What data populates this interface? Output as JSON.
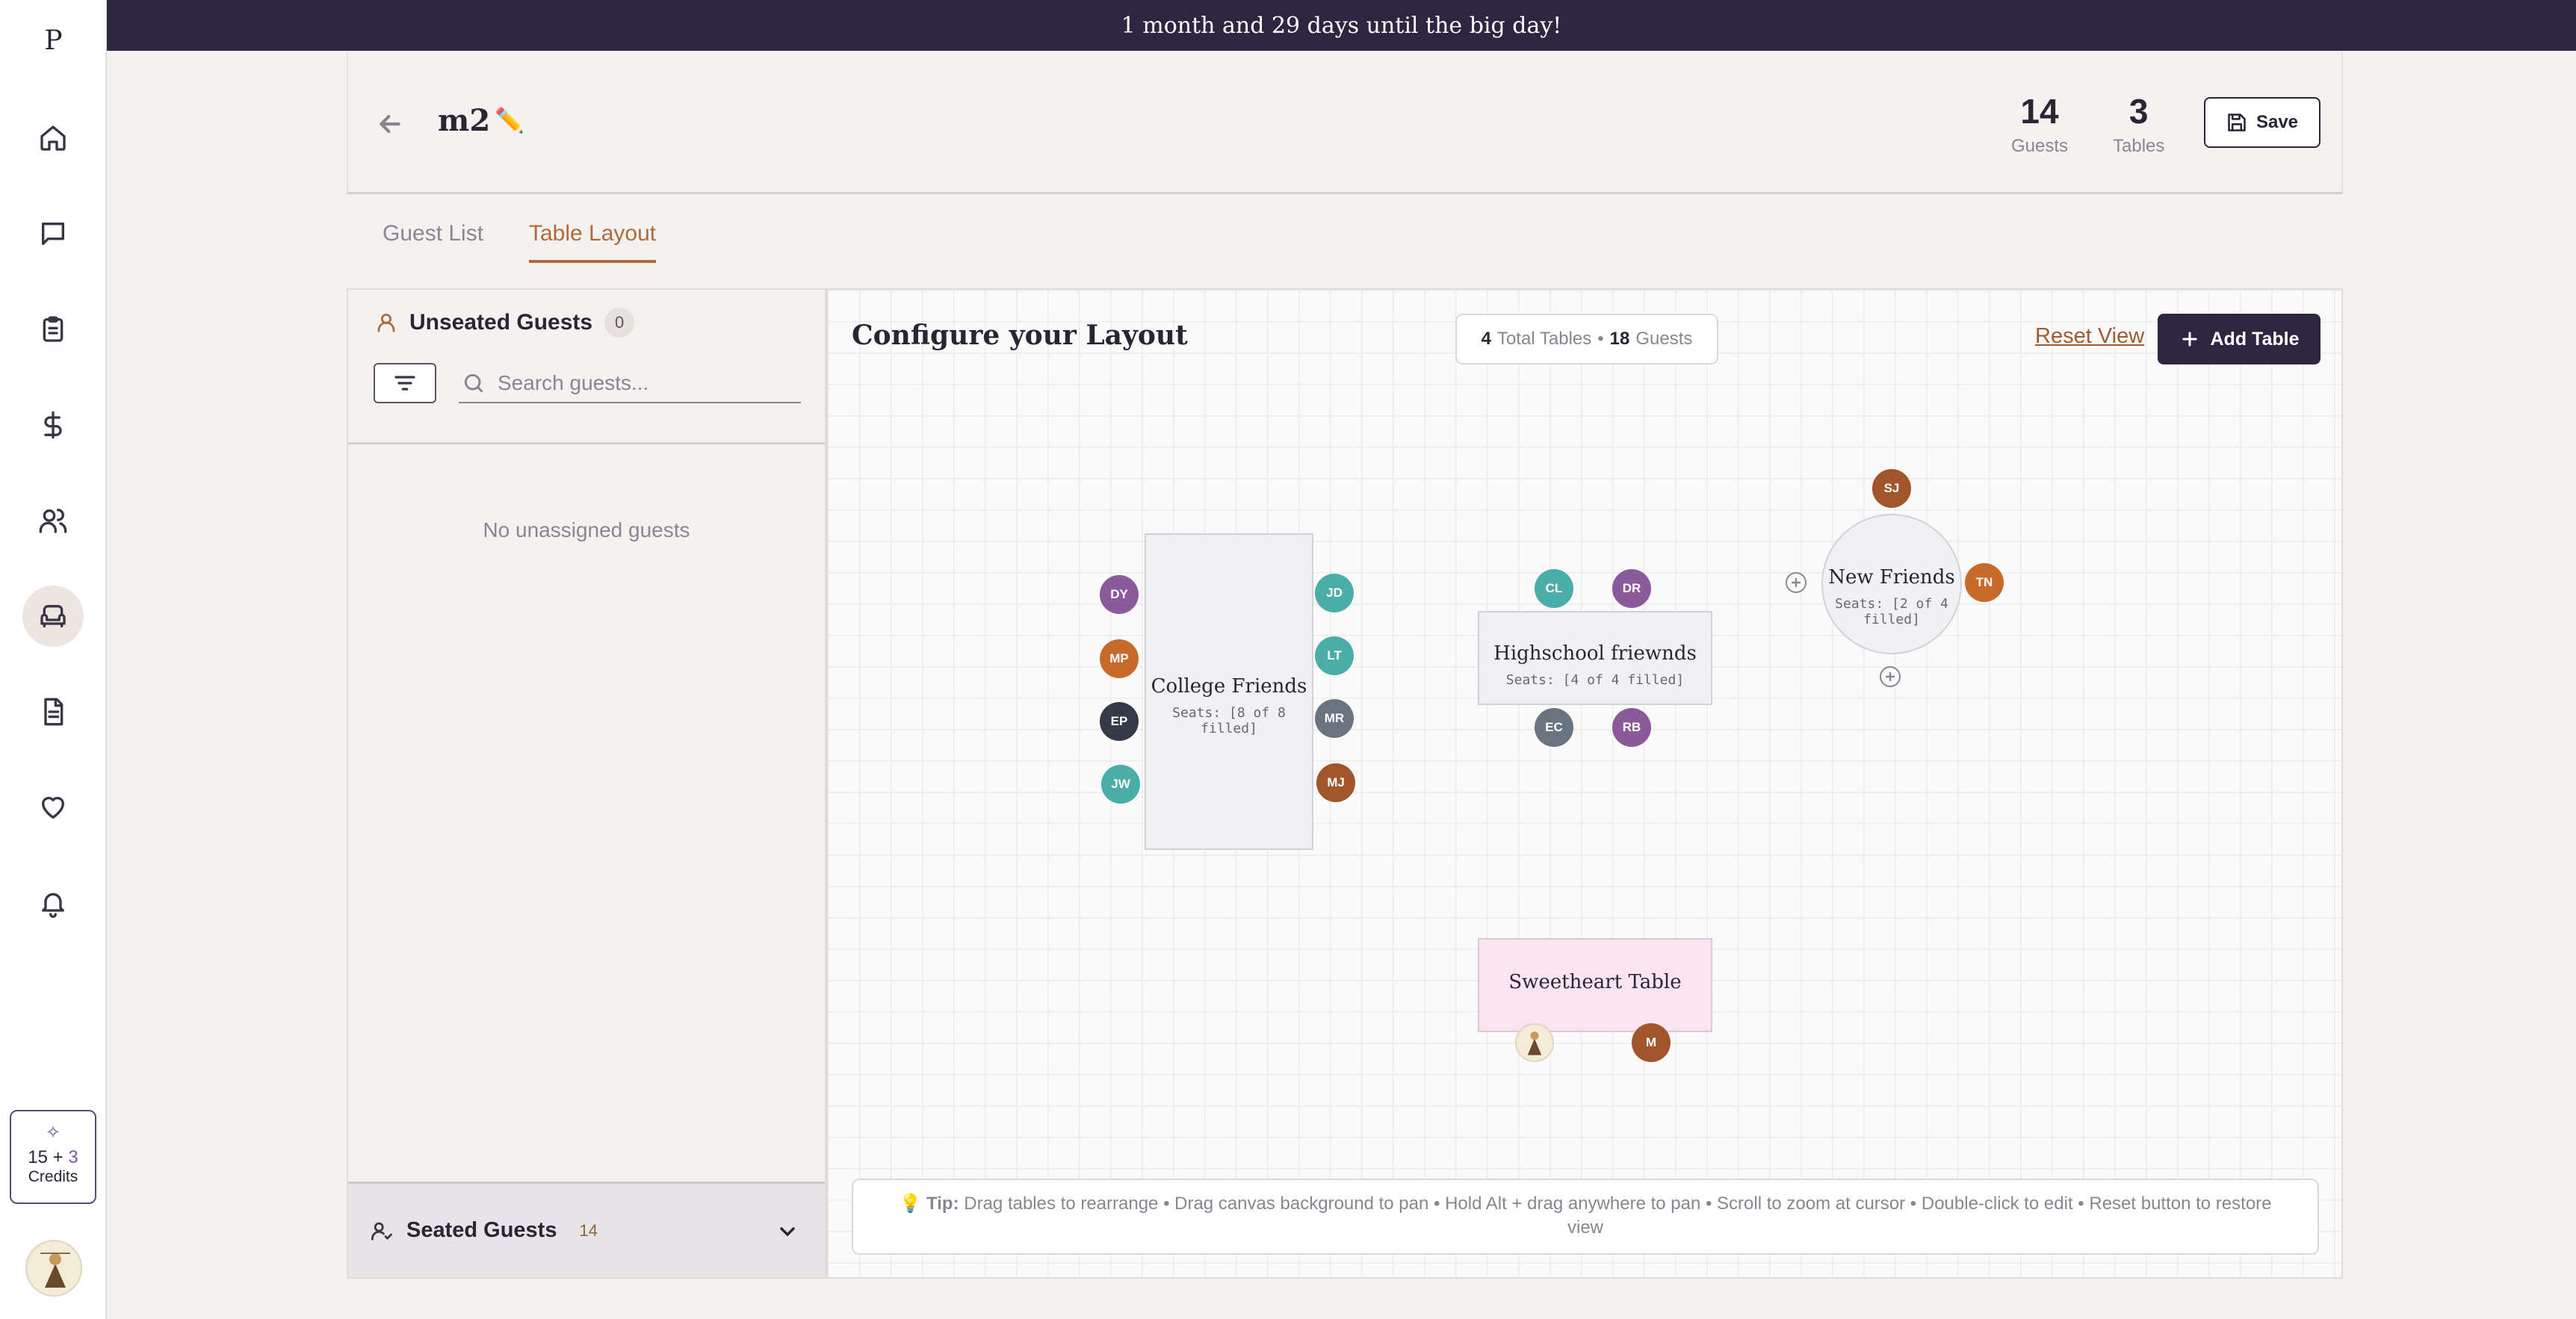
{
  "sidebar": {
    "logo": "P",
    "items": [
      {
        "name": "home",
        "active": false
      },
      {
        "name": "messages",
        "active": false
      },
      {
        "name": "checklist",
        "active": false
      },
      {
        "name": "budget",
        "active": false
      },
      {
        "name": "guests",
        "active": false
      },
      {
        "name": "seating",
        "active": true
      },
      {
        "name": "documents",
        "active": false
      },
      {
        "name": "favorites",
        "active": false
      },
      {
        "name": "notifications",
        "active": false
      }
    ],
    "credits": {
      "base": "15",
      "plus": "+",
      "bonus": "3",
      "label": "Credits"
    }
  },
  "banner": {
    "text": "1 month and 29 days until the big day!"
  },
  "header": {
    "title": "m2",
    "edit_icon": "✏️",
    "guests": {
      "value": "14",
      "label": "Guests"
    },
    "tables": {
      "value": "3",
      "label": "Tables"
    },
    "save_label": "Save"
  },
  "tabs": [
    {
      "label": "Guest List",
      "active": false
    },
    {
      "label": "Table Layout",
      "active": true
    }
  ],
  "left_panel": {
    "unseated_title": "Unseated Guests",
    "unseated_count": "0",
    "search_placeholder": "Search guests...",
    "empty_message": "No unassigned guests",
    "seated_title": "Seated Guests",
    "seated_count": "14"
  },
  "canvas": {
    "title": "Configure your Layout",
    "total_tables": "4",
    "total_tables_label": "Total Tables",
    "separator": "•",
    "total_guests": "18",
    "total_guests_label": "Guests",
    "reset_label": "Reset View",
    "add_table_label": "Add Table",
    "tip_label": "Tip:",
    "tip_text": "Drag tables to rearrange • Drag canvas background to pan • Hold Alt + drag anywhere to pan • Scroll to zoom at cursor • Double-click to edit • Reset button to restore view",
    "tables": [
      {
        "name": "College Friends",
        "seats": "Seats: [8 of 8 filled]"
      },
      {
        "name": "Highschool friewnds",
        "seats": "Seats: [4 of 4 filled]"
      },
      {
        "name": "New Friends",
        "seats": "Seats: [2 of 4 filled]"
      },
      {
        "name": "Sweetheart Table",
        "seats": ""
      }
    ],
    "guests": {
      "college_left": [
        "DY",
        "MP",
        "EP",
        "JW"
      ],
      "college_right": [
        "JD",
        "LT",
        "MR",
        "MJ"
      ],
      "highschool_top": [
        "CL",
        "DR"
      ],
      "highschool_bottom": [
        "EC",
        "RB"
      ],
      "new_friends": [
        "SJ",
        "TN"
      ],
      "sweetheart": [
        "M"
      ]
    }
  },
  "colors": {
    "banner_bg": "#2e2540",
    "accent": "#b06a3a",
    "teal": "#4aaea6",
    "purple": "#8a5a9a",
    "orange": "#c86a2a",
    "slate": "#6a7480",
    "navy": "#343a48",
    "brown": "#a0562a",
    "sweetheart_bg": "#f9e4ef"
  }
}
